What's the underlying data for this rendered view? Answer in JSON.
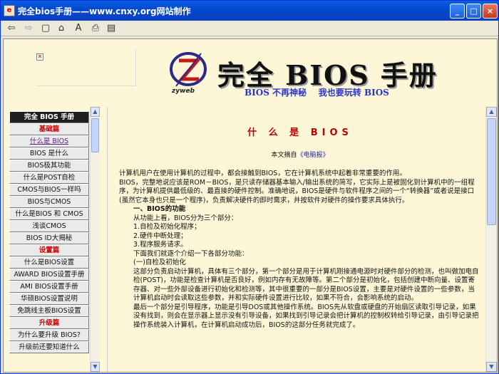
{
  "window": {
    "title": "完全bios手册——www.cnxy.org网站制作",
    "btn_min": "_",
    "btn_max": "□",
    "btn_close": "×"
  },
  "toolbar": {
    "back": "⇦",
    "forward": "⇨",
    "stop": "▢",
    "home": "⌂",
    "font": "A",
    "print": "⎙",
    "options": "▤"
  },
  "banner": {
    "logo_text": "zyweb",
    "title": "完全 BIOS 手册",
    "subtitle": "BIOS 不再神秘    我也要玩转 BIOS"
  },
  "nav": {
    "items": [
      {
        "label": "完全 BIOS 手册",
        "kind": "head"
      },
      {
        "label": "基础篇",
        "kind": "section"
      },
      {
        "label": "什么是 BIOS",
        "kind": "active"
      },
      {
        "label": "BIOS 是什么",
        "kind": "item"
      },
      {
        "label": "BIOS极其功能",
        "kind": "item"
      },
      {
        "label": "什么是POST自检",
        "kind": "item"
      },
      {
        "label": "CMOS与BIOS一样吗",
        "kind": "item"
      },
      {
        "label": "BIOS与CMOS",
        "kind": "item"
      },
      {
        "label": "什么是BIOS 和 CMOS",
        "kind": "item"
      },
      {
        "label": "浅谈CMOS",
        "kind": "item"
      },
      {
        "label": "BIOS ID大揭秘",
        "kind": "item"
      },
      {
        "label": "设置篇",
        "kind": "section"
      },
      {
        "label": "什么是BIOS设置",
        "kind": "item"
      },
      {
        "label": "AWARD BIOS设置手册",
        "kind": "item"
      },
      {
        "label": "AMI BIOS设置手册",
        "kind": "item"
      },
      {
        "label": "华硕BIOS设置说明",
        "kind": "item"
      },
      {
        "label": "免跳线主板BIOS设置",
        "kind": "item"
      },
      {
        "label": "升级篇",
        "kind": "section"
      },
      {
        "label": "为什么要升级 BIOS?",
        "kind": "item"
      },
      {
        "label": "升级前还要知道什么",
        "kind": "item"
      }
    ]
  },
  "main": {
    "title": "什 么 是 BIOS",
    "byline_prefix": "本文摘自",
    "byline_link": "《电脑报》",
    "paragraphs": [
      {
        "text": "计算机用户在使用计算机的过程中，都会接触到BIOS，它在计算机系统中起着非常重要的作用。",
        "style": ""
      },
      {
        "text": "BIOS，完整地说应该是ROM－BIOS，是只读存储器基本输入/输出系统的简写，它实际上是被固化到计算机中的一组程序，为计算机提供最低级的、最直接的硬件控制。准确地说，BIOS是硬件与软件程序之间的一个“转换器”或者说是接口(虽然它本身也只是一个程序)，负责解决硬件的即时需求，并按软件对硬件的操作要求具体执行。",
        "style": ""
      },
      {
        "text": "一、BIOS的功能",
        "style": "ind b"
      },
      {
        "text": " ",
        "style": ""
      },
      {
        "text": "从功能上看，BIOS分为三个部分：",
        "style": "ind"
      },
      {
        "text": "1.自检及初始化程序；",
        "style": "ind"
      },
      {
        "text": "2.硬件中断处理；",
        "style": "ind"
      },
      {
        "text": "3.程序服务请求。",
        "style": "ind"
      },
      {
        "text": "下面我们就逐个介绍一下各部分功能：",
        "style": "ind"
      },
      {
        "text": " ",
        "style": ""
      },
      {
        "text": "(一)自检及初始化",
        "style": "ind"
      },
      {
        "text": "这部分负责启动计算机，具体有三个部分，第一个部分是用于计算机刚接通电源时对硬件部分的检测，也叫做加电自检(POST)，功能是检查计算机是否良好，例如内存有无故障等。第二个部分是初始化，包括创建中断向量、设置寄存器、对一些外部设备进行初始化和检测等，其中很重要的一部分是BIOS设置，主要是对硬件设置的一些参数，当计算机启动时会读取这些参数，并和实际硬件设置进行比较，如果不符合，会影响系统的启动。",
        "style": "ind"
      },
      {
        "text": "最后一个部分是引导程序，功能是引导DOS或其他操作系统。BIOS先从软盘或硬盘的开始扇区读取引导记录，如果没有找到，则会在显示器上显示没有引导设备，如果找到引导记录会把计算机的控制权转给引导记录，由引导记录把操作系统装入计算机，在计算机启动成功后，BIOS的这部分任务就完成了。",
        "style": "ind"
      }
    ]
  }
}
